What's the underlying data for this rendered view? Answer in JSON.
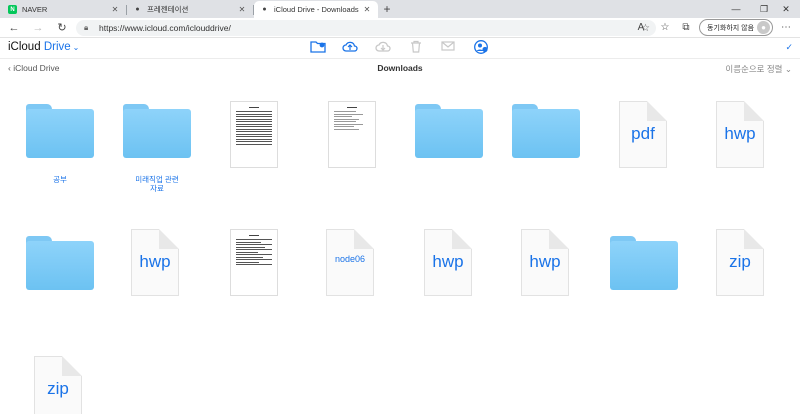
{
  "browser": {
    "tabs": [
      {
        "label": "NAVER",
        "icon": "naver-icon"
      },
      {
        "label": "프레젠테이션",
        "icon": "apple-icon"
      },
      {
        "label": "iCloud Drive - Downloads",
        "icon": "apple-icon"
      }
    ],
    "url": "https://www.icloud.com/iclouddrive/",
    "sync_label": "동기화하지 않음"
  },
  "icloud": {
    "brand_prefix": "iCloud",
    "brand_suffix": "Drive",
    "back_label": "iCloud Drive",
    "current_folder": "Downloads",
    "sort_label": "이름순으로 정렬"
  },
  "items": [
    {
      "type": "folder",
      "label": "공부"
    },
    {
      "type": "folder",
      "label": "미래직업 관련",
      "label2": "자료"
    },
    {
      "type": "thumbnail"
    },
    {
      "type": "thumbnail"
    },
    {
      "type": "folder"
    },
    {
      "type": "folder"
    },
    {
      "type": "file",
      "ext": "pdf"
    },
    {
      "type": "file",
      "ext": "hwp"
    },
    {
      "type": "folder"
    },
    {
      "type": "file",
      "ext": "hwp"
    },
    {
      "type": "thumbnail"
    },
    {
      "type": "file",
      "ext": "node06"
    },
    {
      "type": "file",
      "ext": "hwp"
    },
    {
      "type": "file",
      "ext": "hwp"
    },
    {
      "type": "folder"
    },
    {
      "type": "file",
      "ext": "zip"
    },
    {
      "type": "file",
      "ext": "zip"
    }
  ],
  "colors": {
    "accent": "#1a73e8",
    "folder": "#7ec8f4"
  }
}
